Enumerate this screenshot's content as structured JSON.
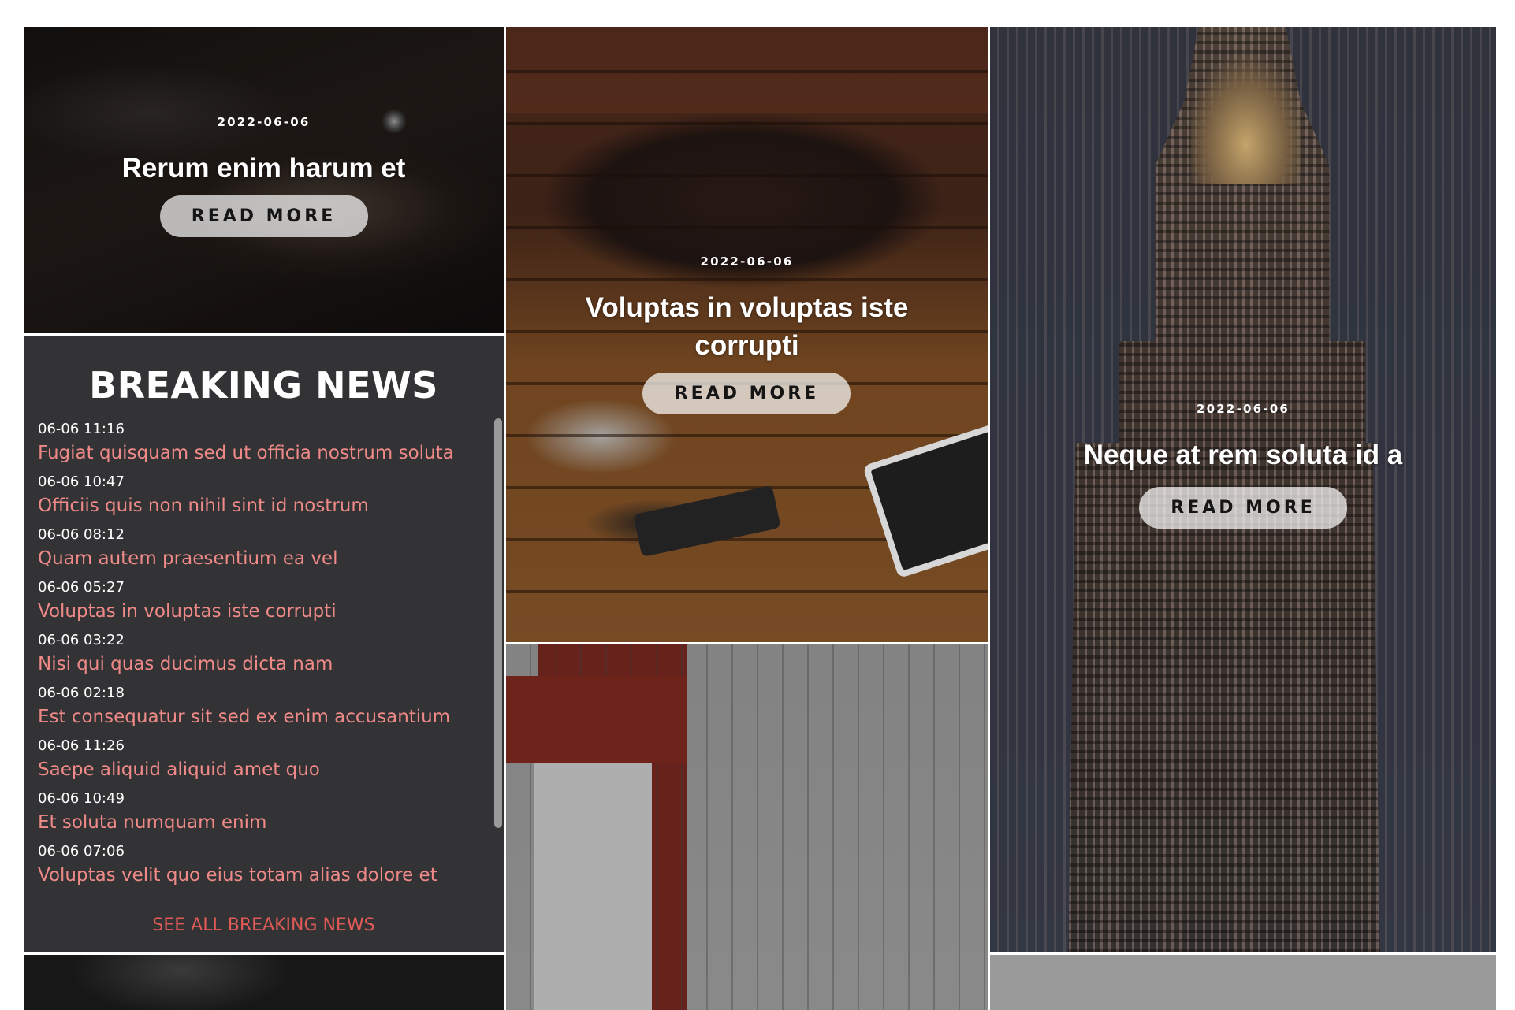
{
  "tiles": [
    {
      "date": "2022-06-06",
      "title_lines": [
        "Rerum enim harum et"
      ],
      "button": "READ MORE"
    },
    {
      "date": "2022-06-06",
      "title_lines": [
        "Voluptas in voluptas iste",
        "corrupti"
      ],
      "button": "READ MORE"
    },
    {
      "date": "2022-06-06",
      "title_lines": [
        "Neque at rem soluta id a"
      ],
      "button": "READ MORE"
    }
  ],
  "breaking_news": {
    "heading": "BREAKING NEWS",
    "items": [
      {
        "time": "06-06 11:16",
        "title": "Fugiat quisquam sed ut officia nostrum soluta"
      },
      {
        "time": "06-06 10:47",
        "title": "Officiis quis non nihil sint id nostrum"
      },
      {
        "time": "06-06 08:12",
        "title": "Quam autem praesentium ea vel"
      },
      {
        "time": "06-06 05:27",
        "title": "Voluptas in voluptas iste corrupti"
      },
      {
        "time": "06-06 03:22",
        "title": "Nisi qui quas ducimus dicta nam"
      },
      {
        "time": "06-06 02:18",
        "title": "Est consequatur sit sed ex enim accusantium"
      },
      {
        "time": "06-06 11:26",
        "title": "Saepe aliquid aliquid amet quo"
      },
      {
        "time": "06-06 10:49",
        "title": "Et soluta numquam enim"
      },
      {
        "time": "06-06 07:06",
        "title": "Voluptas velit quo eius totam alias dolore et"
      }
    ],
    "see_all": "SEE ALL BREAKING NEWS"
  },
  "colors": {
    "link": "#f08a88",
    "see_all": "#e05a56",
    "panel_bg": "#333335"
  }
}
